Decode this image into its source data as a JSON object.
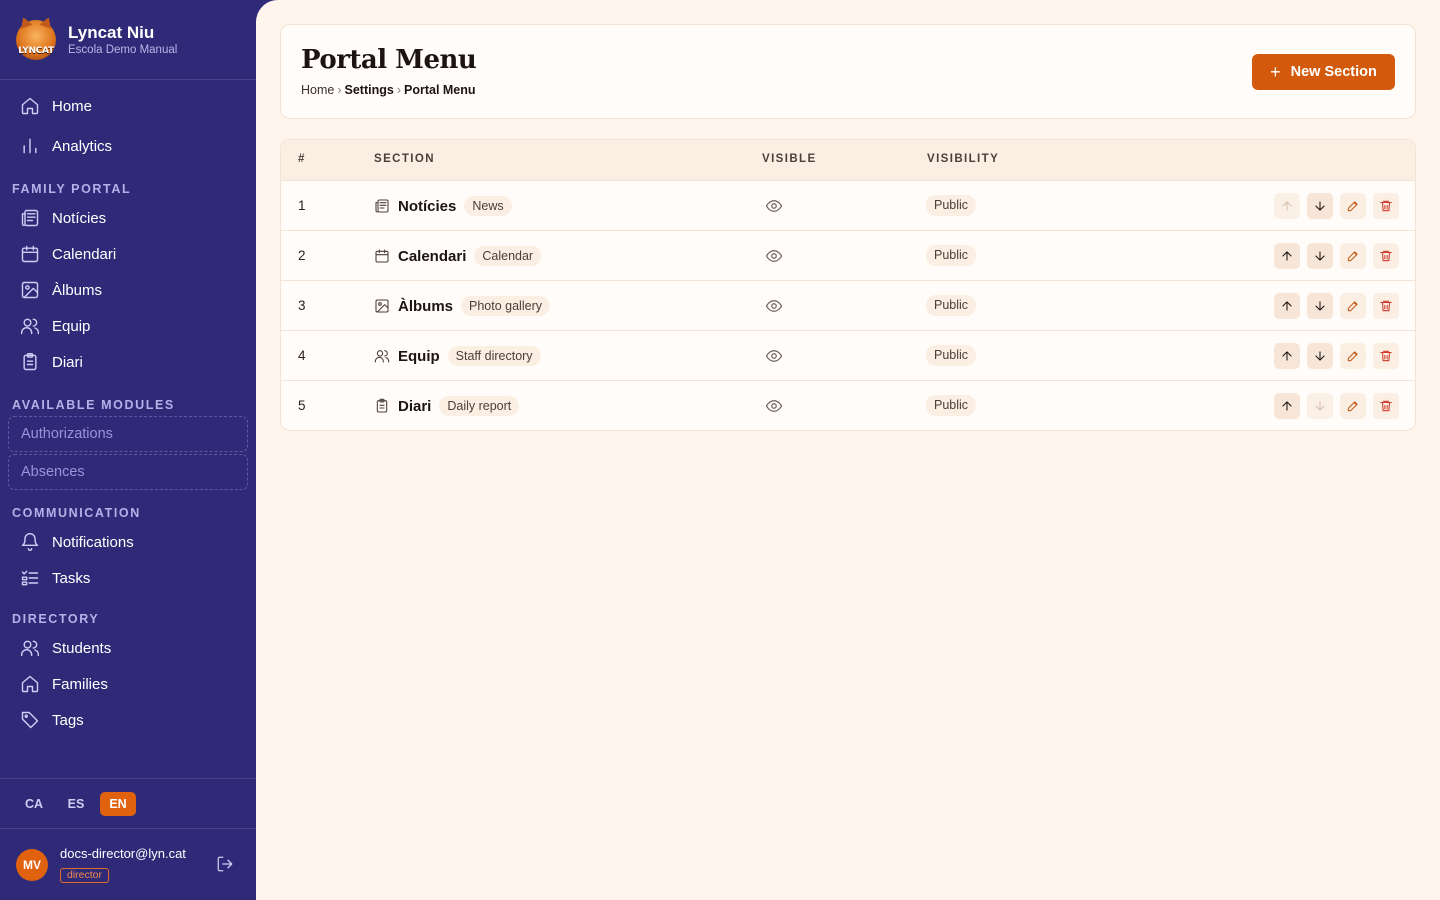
{
  "brand": {
    "name": "Lyncat Niu",
    "subtitle": "Escola Demo Manual",
    "logo_text": "LYNCAT"
  },
  "nav": {
    "top": [
      {
        "label": "Home",
        "icon": "home-icon"
      },
      {
        "label": "Analytics",
        "icon": "bar-chart-icon"
      }
    ],
    "family_portal_title": "FAMILY PORTAL",
    "family_portal": [
      {
        "label": "Notícies",
        "icon": "newspaper-icon"
      },
      {
        "label": "Calendari",
        "icon": "calendar-icon"
      },
      {
        "label": "Àlbums",
        "icon": "image-icon"
      },
      {
        "label": "Equip",
        "icon": "users-icon"
      },
      {
        "label": "Diari",
        "icon": "clipboard-icon"
      }
    ],
    "modules_title": "AVAILABLE MODULES",
    "modules": [
      {
        "label": "Authorizations"
      },
      {
        "label": "Absences"
      }
    ],
    "communication_title": "COMMUNICATION",
    "communication": [
      {
        "label": "Notifications",
        "icon": "bell-icon"
      },
      {
        "label": "Tasks",
        "icon": "list-check-icon"
      }
    ],
    "directory_title": "DIRECTORY",
    "directory": [
      {
        "label": "Students",
        "icon": "users-icon"
      },
      {
        "label": "Families",
        "icon": "home-icon"
      },
      {
        "label": "Tags",
        "icon": "tag-icon"
      }
    ]
  },
  "languages": [
    {
      "code": "CA"
    },
    {
      "code": "ES"
    },
    {
      "code": "EN",
      "active": true
    }
  ],
  "user": {
    "initials": "MV",
    "email": "docs-director@lyn.cat",
    "role": "director"
  },
  "header": {
    "title": "Portal Menu",
    "breadcrumb": [
      "Home",
      "Settings",
      "Portal Menu"
    ],
    "new_button": "New Section"
  },
  "table": {
    "columns": [
      "#",
      "SECTION",
      "VISIBLE",
      "VISIBILITY"
    ],
    "rows": [
      {
        "num": "1",
        "name": "Notícies",
        "chip": "News",
        "visibility": "Public",
        "icon": "newspaper-icon",
        "up_disabled": true,
        "down_disabled": false
      },
      {
        "num": "2",
        "name": "Calendari",
        "chip": "Calendar",
        "visibility": "Public",
        "icon": "calendar-icon",
        "up_disabled": false,
        "down_disabled": false
      },
      {
        "num": "3",
        "name": "Àlbums",
        "chip": "Photo gallery",
        "visibility": "Public",
        "icon": "image-icon",
        "up_disabled": false,
        "down_disabled": false
      },
      {
        "num": "4",
        "name": "Equip",
        "chip": "Staff directory",
        "visibility": "Public",
        "icon": "users-icon",
        "up_disabled": false,
        "down_disabled": false
      },
      {
        "num": "5",
        "name": "Diari",
        "chip": "Daily report",
        "visibility": "Public",
        "icon": "clipboard-icon",
        "up_disabled": false,
        "down_disabled": true
      }
    ]
  },
  "colors": {
    "sidebar": "#2e2a78",
    "accent": "#d35a0c",
    "background": "#fff5ec"
  }
}
